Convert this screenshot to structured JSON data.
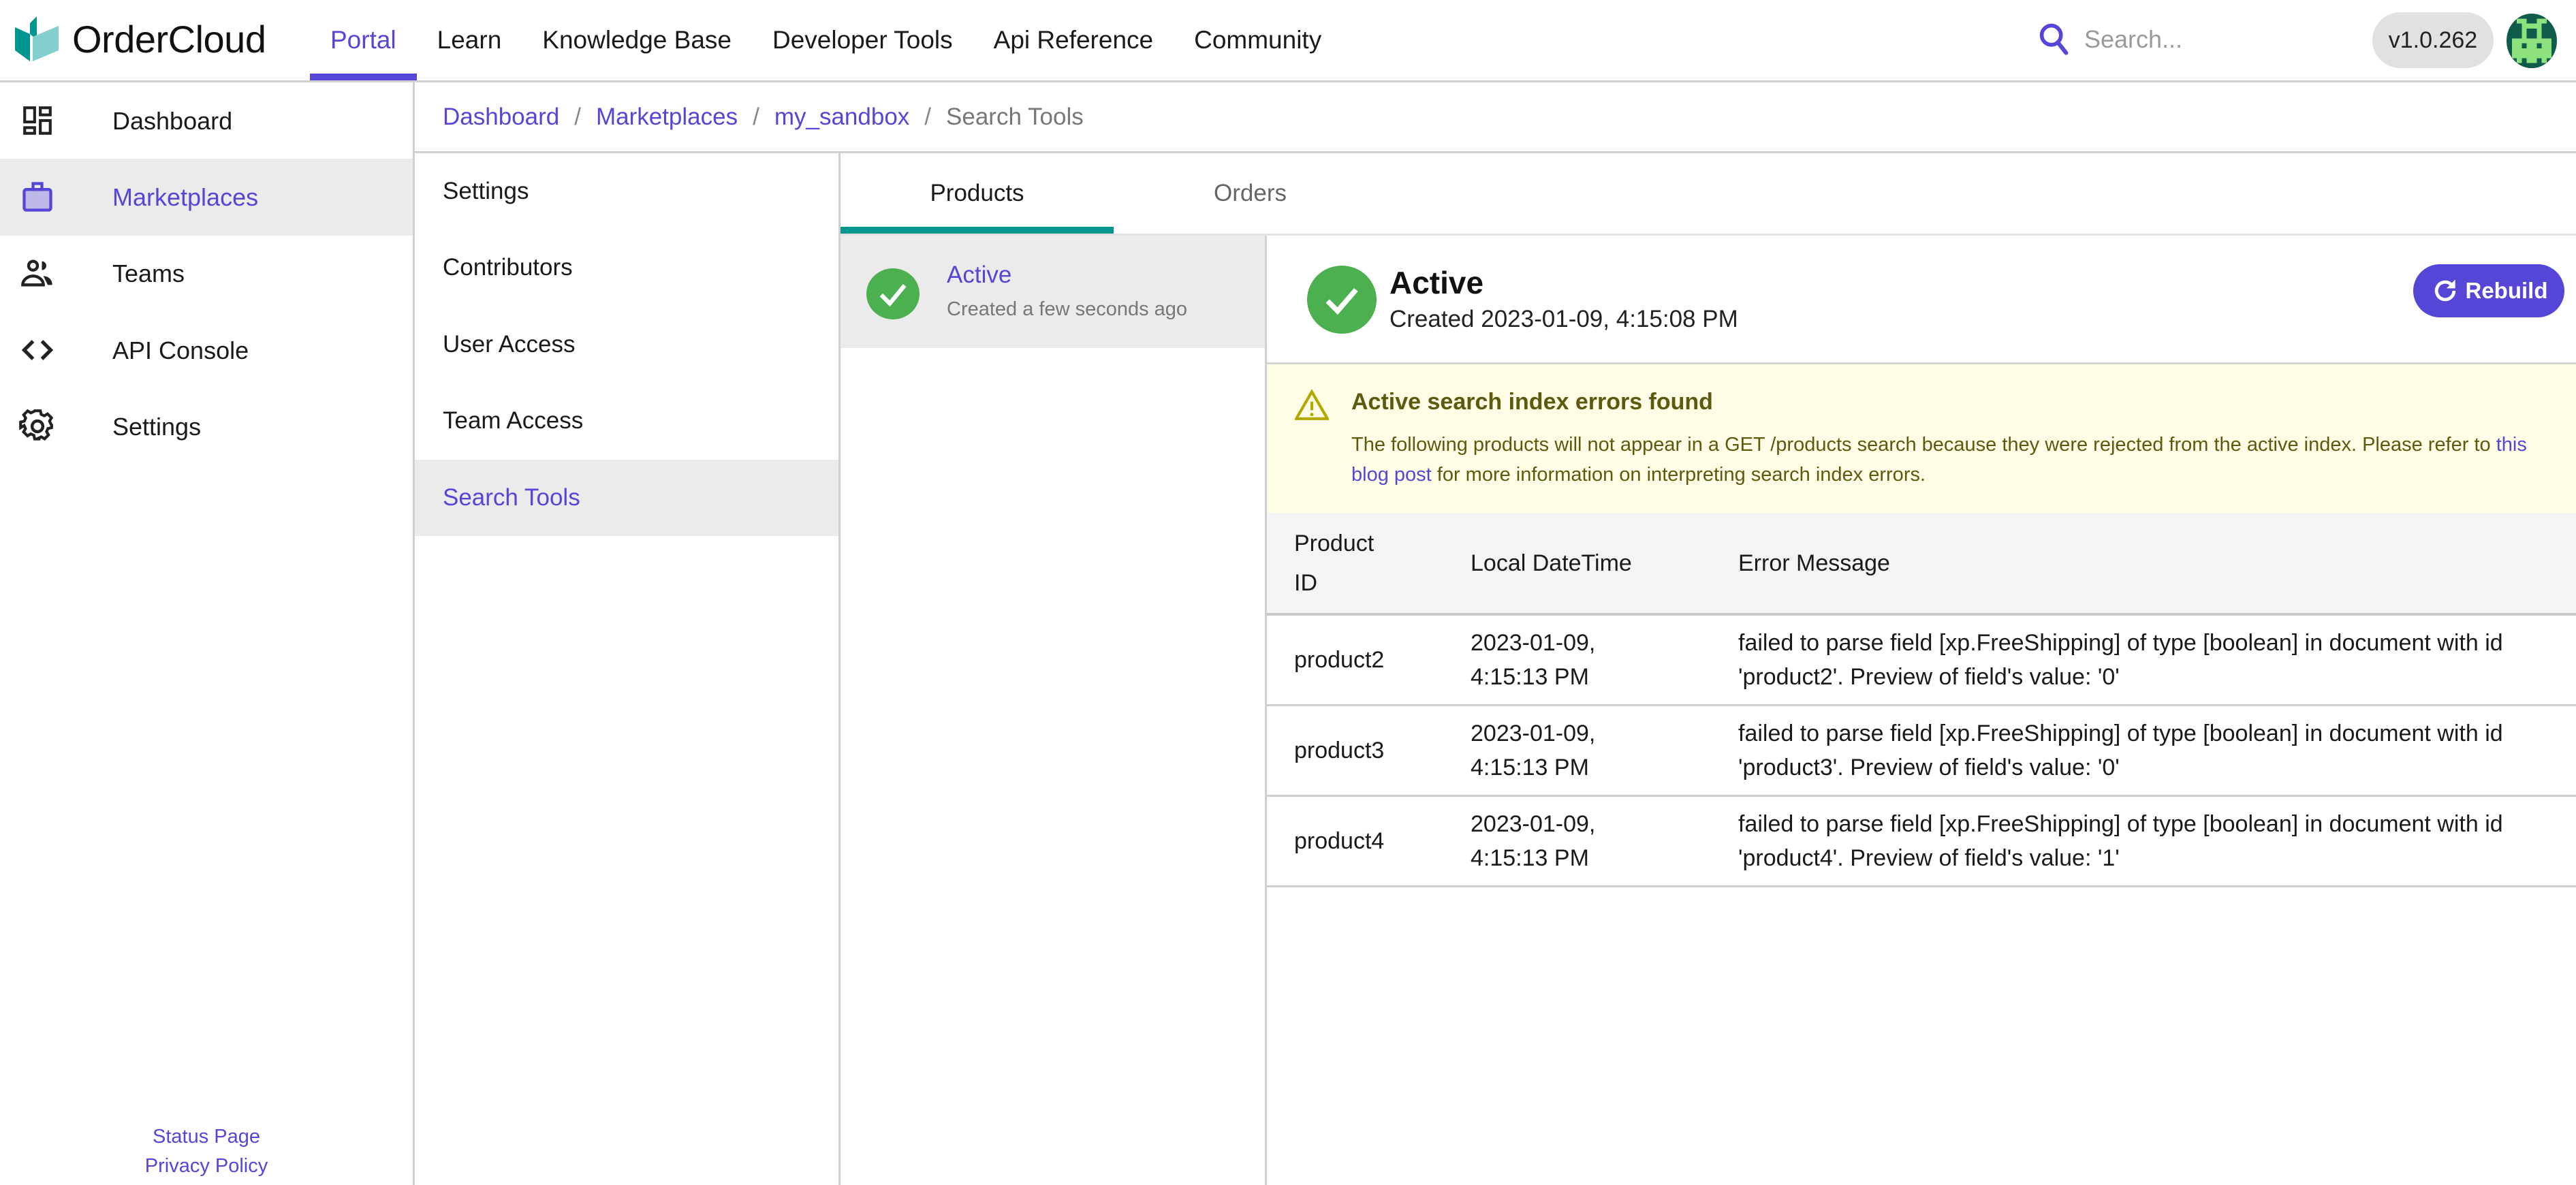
{
  "header": {
    "brand": "OrderCloud",
    "nav": [
      {
        "label": "Portal",
        "active": true
      },
      {
        "label": "Learn",
        "active": false
      },
      {
        "label": "Knowledge Base",
        "active": false
      },
      {
        "label": "Developer Tools",
        "active": false
      },
      {
        "label": "Api Reference",
        "active": false
      },
      {
        "label": "Community",
        "active": false
      }
    ],
    "search": {
      "placeholder": "Search...",
      "value": ""
    },
    "version": "v1.0.262",
    "icons": {
      "search": "search-icon",
      "avatar": "pixel-avatar"
    }
  },
  "sidebar": {
    "items": [
      {
        "label": "Dashboard",
        "icon": "dashboard-icon",
        "active": false
      },
      {
        "label": "Marketplaces",
        "icon": "briefcase-icon",
        "active": true
      },
      {
        "label": "Teams",
        "icon": "people-icon",
        "active": false
      },
      {
        "label": "API Console",
        "icon": "code-icon",
        "active": false
      },
      {
        "label": "Settings",
        "icon": "gear-icon",
        "active": false
      }
    ],
    "footer": {
      "status_page": "Status Page",
      "privacy_policy": "Privacy Policy"
    }
  },
  "breadcrumb": [
    {
      "label": "Dashboard",
      "link": true
    },
    {
      "label": "Marketplaces",
      "link": true
    },
    {
      "label": "my_sandbox",
      "link": true
    },
    {
      "label": "Search Tools",
      "link": false
    }
  ],
  "breadcrumb_separator": "/",
  "subnav": {
    "items": [
      {
        "label": "Settings",
        "active": false
      },
      {
        "label": "Contributors",
        "active": false
      },
      {
        "label": "User Access",
        "active": false
      },
      {
        "label": "Team Access",
        "active": false
      },
      {
        "label": "Search Tools",
        "active": true
      }
    ]
  },
  "tabs": [
    {
      "label": "Products",
      "active": true
    },
    {
      "label": "Orders",
      "active": false
    }
  ],
  "index_list": [
    {
      "status": "Active",
      "created": "Created a few seconds ago",
      "icon": "check-circle-icon"
    }
  ],
  "detail": {
    "status": "Active",
    "created": "Created 2023-01-09, 4:15:08 PM",
    "rebuild_label": "Rebuild",
    "banner": {
      "title": "Active search index errors found",
      "text_before": "The following products will not appear in a GET /products search because they were rejected from the active index. Please refer to ",
      "link_text": "this blog post",
      "text_after": " for more information on interpreting search index errors.",
      "icon": "warning-icon"
    },
    "table": {
      "columns": [
        "Product ID",
        "Local DateTime",
        "Error Message"
      ],
      "rows": [
        {
          "product_id": "product2",
          "datetime_date": "2023-01-09,",
          "datetime_time": "4:15:13 PM",
          "error": "failed to parse field [xp.FreeShipping] of type [boolean] in document with id 'product2'. Preview of field's value: '0'"
        },
        {
          "product_id": "product3",
          "datetime_date": "2023-01-09,",
          "datetime_time": "4:15:13 PM",
          "error": "failed to parse field [xp.FreeShipping] of type [boolean] in document with id 'product3'. Preview of field's value: '0'"
        },
        {
          "product_id": "product4",
          "datetime_date": "2023-01-09,",
          "datetime_time": "4:15:13 PM",
          "error": "failed to parse field [xp.FreeShipping] of type [boolean] in document with id 'product4'. Preview of field's value: '1'"
        }
      ]
    }
  },
  "colors": {
    "accent": "#5546d8",
    "teal": "#009690",
    "success": "#4caf50",
    "warning_bg": "#fffde5",
    "warning_text": "#5c5a0e",
    "highlight_bg": "#ebebeb"
  }
}
